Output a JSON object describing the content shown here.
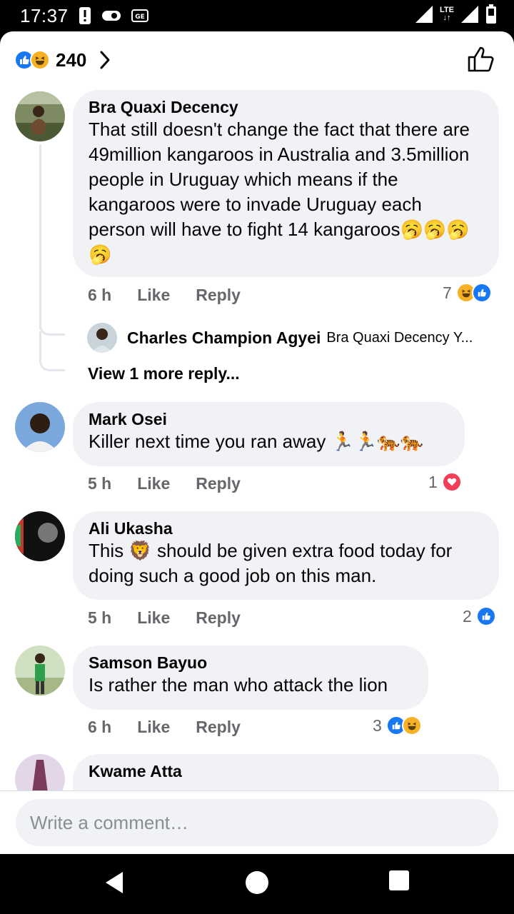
{
  "status_bar": {
    "time": "17:37",
    "network": "LTE"
  },
  "header": {
    "reaction_total": "240"
  },
  "comments": [
    {
      "author": "Bra Quaxi Decency",
      "text": "That still doesn't change the fact that there are 49million kangaroos in Australia and 3.5million people in Uruguay which means if the kangaroos were to invade Uruguay each person will have to fight 14 kangaroos🥱🥱🥱🥱",
      "time": "6 h",
      "like": "Like",
      "reply": "Reply",
      "reaction_count": "7"
    },
    {
      "author": "Mark Osei",
      "text": "Killer next time you ran away 🏃🏃🐅🐅",
      "time": "5 h",
      "like": "Like",
      "reply": "Reply",
      "reaction_count": "1"
    },
    {
      "author": "Ali Ukasha",
      "text": "This 🦁 should be given extra food today for doing such a good job on this man.",
      "time": "5 h",
      "like": "Like",
      "reply": "Reply",
      "reaction_count": "2"
    },
    {
      "author": "Samson Bayuo",
      "text": "Is rather the man who attack the lion",
      "time": "6 h",
      "like": "Like",
      "reply": "Reply",
      "reaction_count": "3"
    },
    {
      "author": "Kwame Atta"
    }
  ],
  "reply_preview": {
    "author": "Charles Champion Agyei",
    "snippet": "Bra Quaxi Decency Y..."
  },
  "view_more": "View 1 more reply...",
  "composer": {
    "placeholder": "Write a comment…"
  },
  "colors": {
    "like": "#1877f2",
    "haha": "#f7b125",
    "love": "#f33e58",
    "bubble": "#f0f2f5",
    "meta": "#65676b"
  }
}
